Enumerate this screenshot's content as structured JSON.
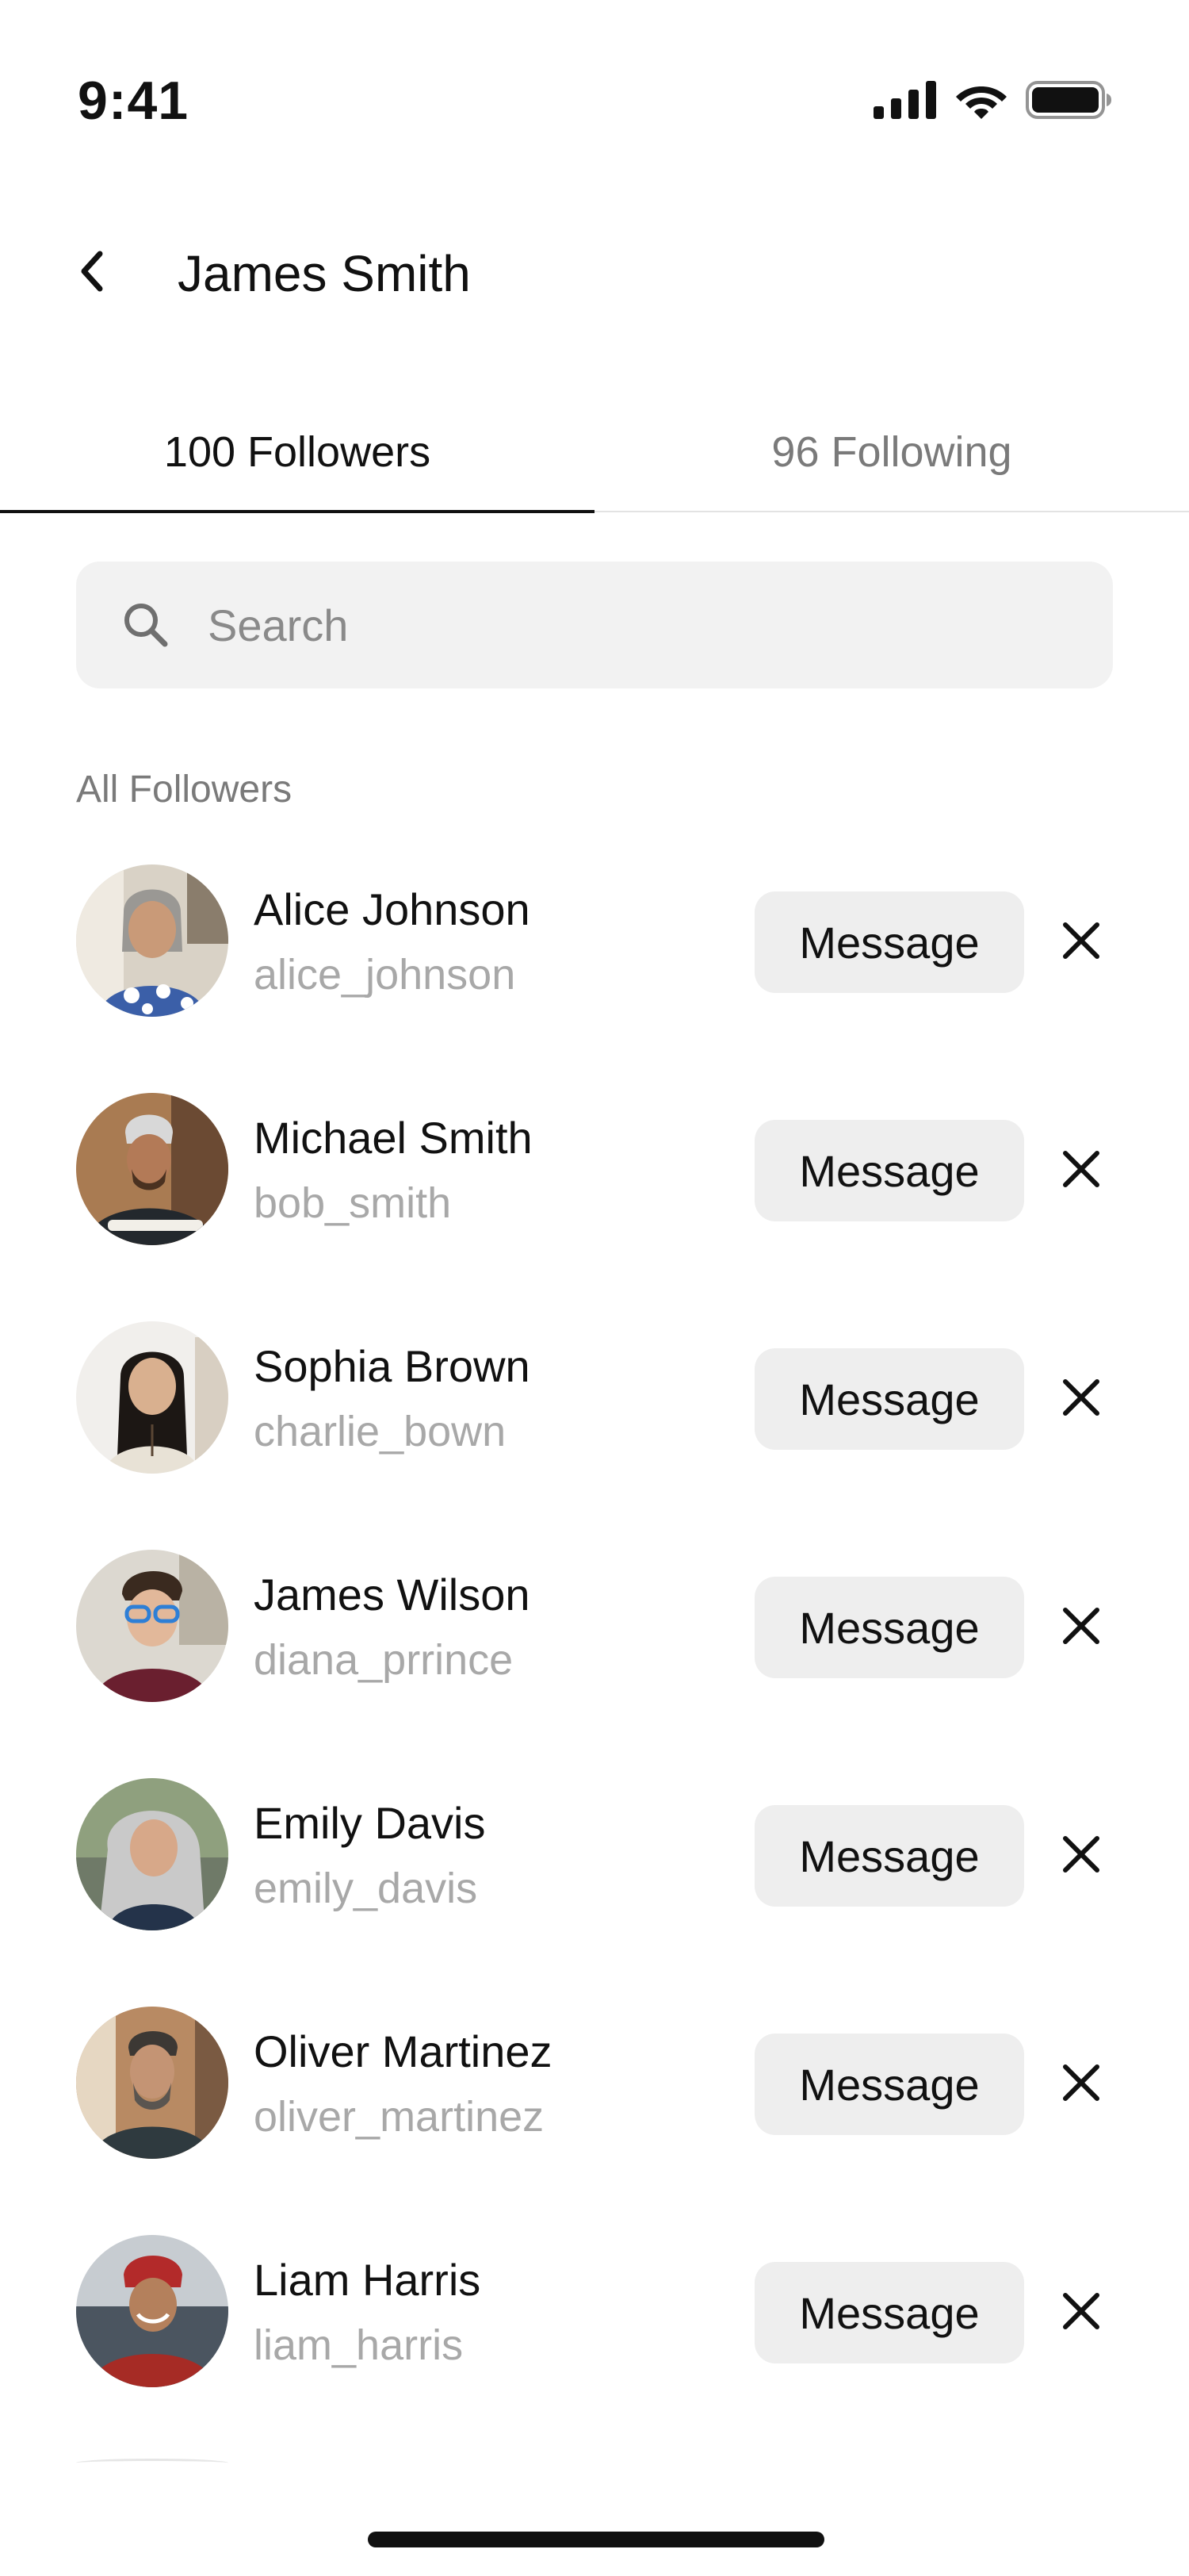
{
  "status_bar": {
    "time": "9:41",
    "icons": [
      "cellular-signal-icon",
      "wifi-icon",
      "battery-icon"
    ]
  },
  "header": {
    "title": "James Smith",
    "back_icon": "chevron-left-icon"
  },
  "tabs": [
    {
      "label": "100 Followers",
      "active": true
    },
    {
      "label": "96 Following",
      "active": false
    }
  ],
  "search": {
    "placeholder": "Search",
    "value": "",
    "icon": "search-icon"
  },
  "section_label": "All Followers",
  "followers": [
    {
      "name": "Alice Johnson",
      "handle": "alice_johnson",
      "message_label": "Message"
    },
    {
      "name": "Michael Smith",
      "handle": "bob_smith",
      "message_label": "Message"
    },
    {
      "name": "Sophia Brown",
      "handle": "charlie_bown",
      "message_label": "Message"
    },
    {
      "name": "James Wilson",
      "handle": "diana_prrince",
      "message_label": "Message"
    },
    {
      "name": "Emily Davis",
      "handle": "emily_davis",
      "message_label": "Message"
    },
    {
      "name": "Oliver Martinez",
      "handle": "oliver_martinez",
      "message_label": "Message"
    },
    {
      "name": "Liam Harris",
      "handle": "liam_harris",
      "message_label": "Message"
    }
  ],
  "colors": {
    "text_primary": "#111111",
    "text_secondary": "#7a7a7a",
    "text_muted": "#a8a8a8",
    "search_background": "#f2f2f2",
    "button_background": "#eeeeee"
  }
}
